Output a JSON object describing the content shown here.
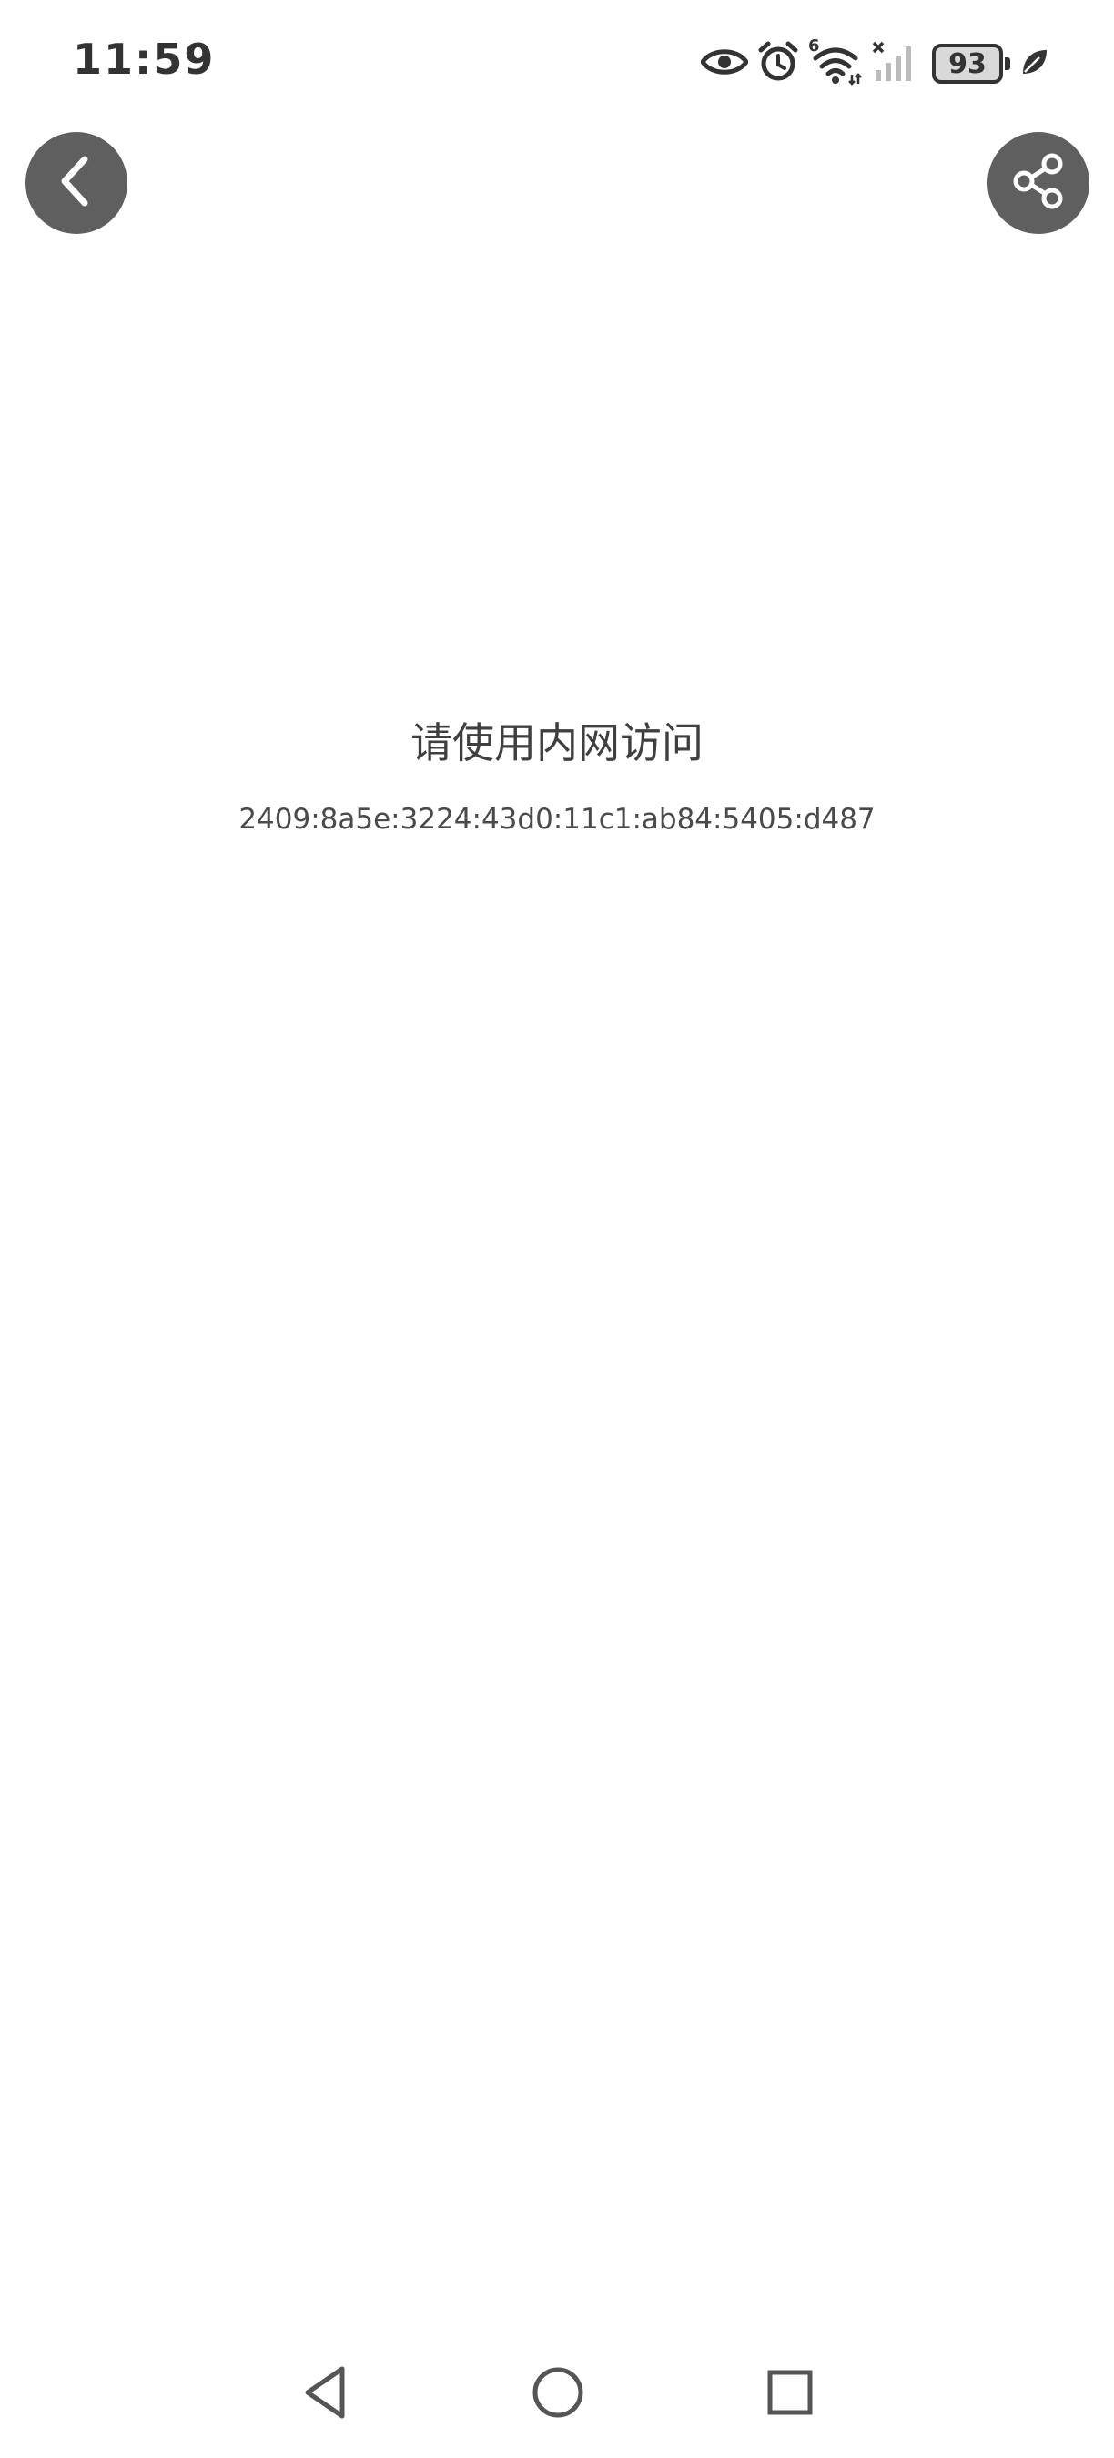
{
  "status_bar": {
    "time": "11:59",
    "battery_level": "93",
    "network_label": "6",
    "icons": [
      "eye-icon",
      "alarm-icon",
      "wifi-icon",
      "signal-icon",
      "battery-icon",
      "leaf-icon"
    ]
  },
  "toolbar": {
    "back_icon": "chevron-left-icon",
    "share_icon": "share-icon"
  },
  "content": {
    "title": "请使用内网访问",
    "address": "2409:8a5e:3224:43d0:11c1:ab84:5405:d487"
  },
  "navigation": {
    "icons": [
      "triangle-back-icon",
      "circle-home-icon",
      "square-recents-icon"
    ]
  },
  "colors": {
    "background": "#ffffff",
    "button_fill": "#5f5f5f",
    "text": "#3f3f3f"
  }
}
